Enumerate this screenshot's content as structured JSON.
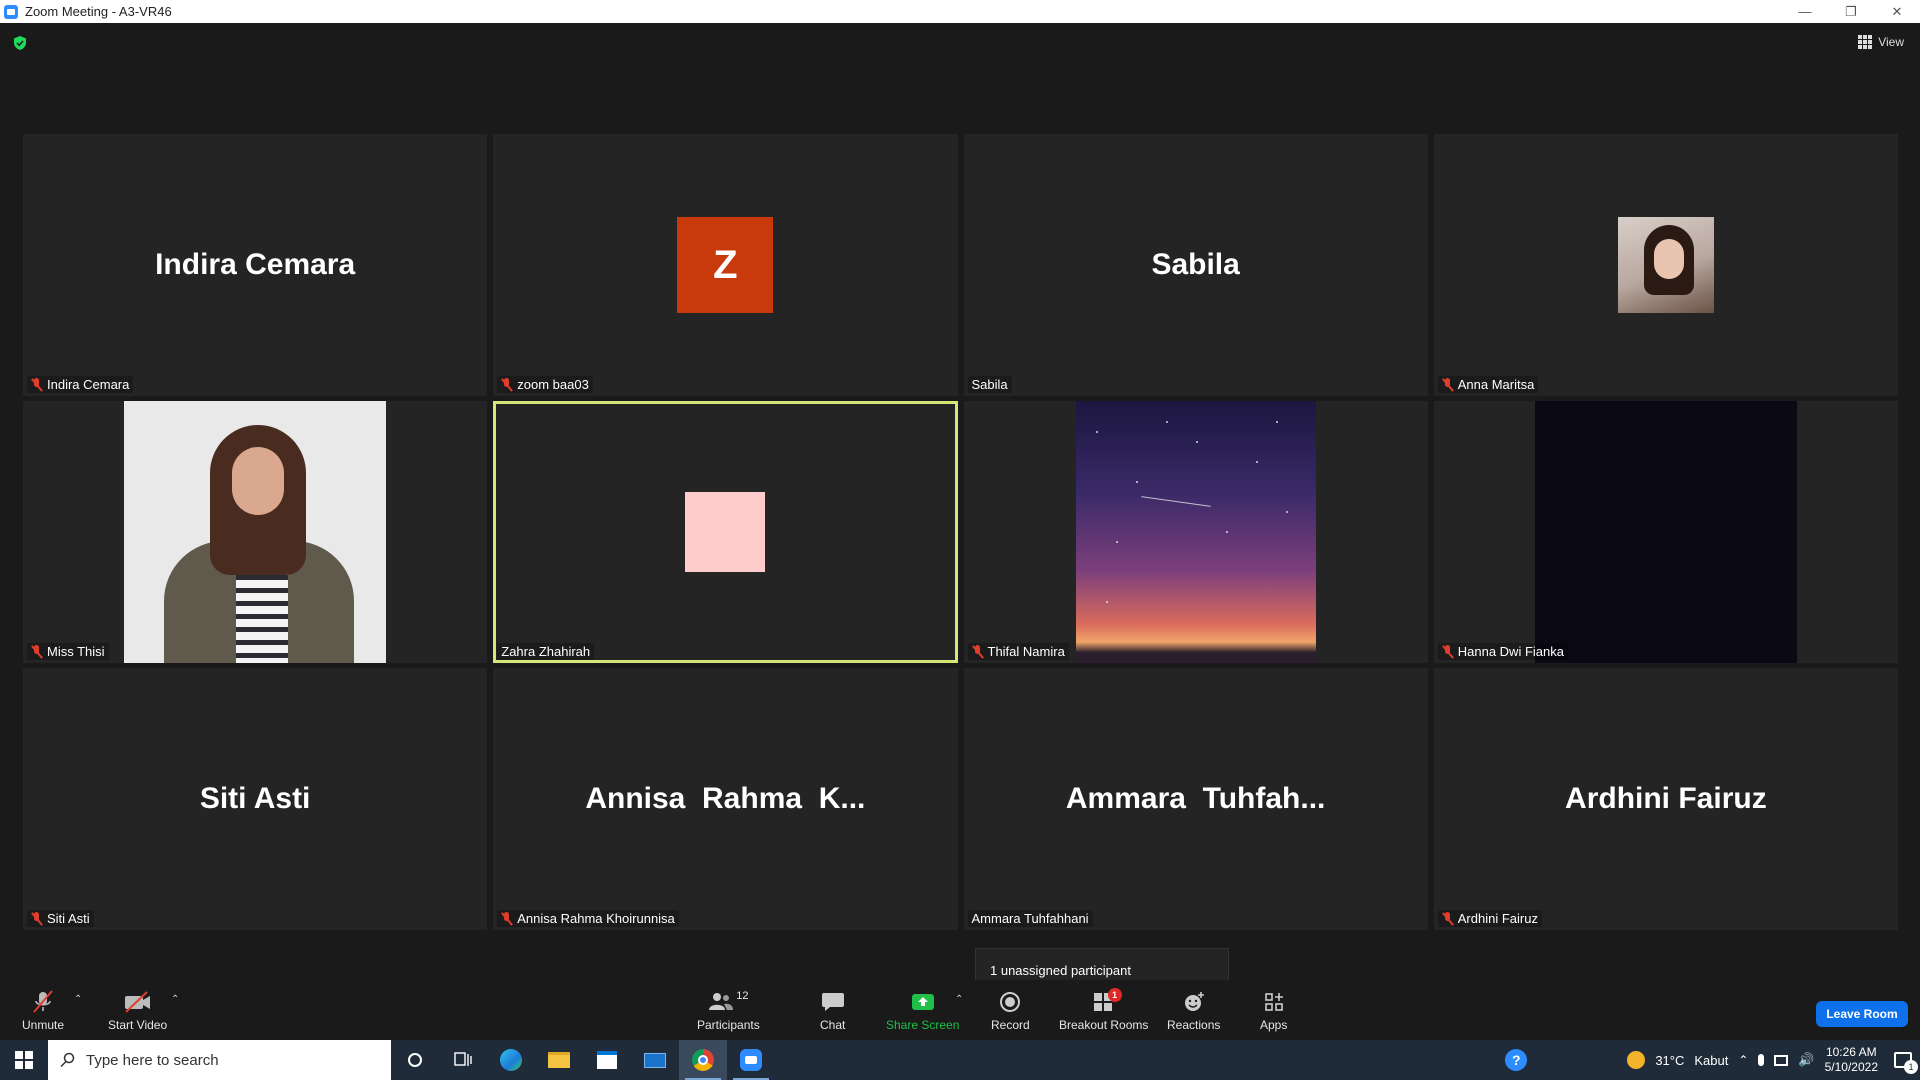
{
  "window": {
    "title": "Zoom Meeting - A3-VR46"
  },
  "header": {
    "view_label": "View"
  },
  "tiles": [
    {
      "display": "Indira Cemara",
      "label": "Indira Cemara",
      "muted": true
    },
    {
      "display": "Z",
      "label": "zoom baa03",
      "muted": true
    },
    {
      "display": "Sabila",
      "label": "Sabila",
      "muted": false
    },
    {
      "display": "",
      "label": "Anna Maritsa",
      "muted": true
    },
    {
      "display": "",
      "label": "Miss Thisi",
      "muted": true
    },
    {
      "display": "",
      "label": "Zahra Zhahirah",
      "muted": false,
      "active_speaker": true
    },
    {
      "display": "",
      "label": "Thifal Namira",
      "muted": true
    },
    {
      "display": "",
      "label": "Hanna Dwi Fianka",
      "muted": true
    },
    {
      "display": "Siti Asti",
      "label": "Siti Asti",
      "muted": true
    },
    {
      "display": "Annisa  Rahma  K...",
      "label": "Annisa Rahma Khoirunnisa",
      "muted": true
    },
    {
      "display": "Ammara  Tuhfah...",
      "label": "Ammara Tuhfahhani",
      "muted": false
    },
    {
      "display": "Ardhini Fairuz",
      "label": "Ardhini Fairuz",
      "muted": true
    }
  ],
  "tooltip": {
    "text": "1 unassigned participant"
  },
  "toolbar": {
    "unmute": "Unmute",
    "start_video": "Start Video",
    "participants": "Participants",
    "participants_count": "12",
    "chat": "Chat",
    "share_screen": "Share Screen",
    "record": "Record",
    "breakout_rooms": "Breakout Rooms",
    "breakout_badge": "1",
    "reactions": "Reactions",
    "apps": "Apps",
    "leave": "Leave Room"
  },
  "taskbar": {
    "search_placeholder": "Type here to search",
    "weather_temp": "31°C",
    "weather_text": "Kabut",
    "time": "10:26 AM",
    "date": "5/10/2022",
    "notification_count": "1"
  },
  "colors": {
    "active_border": "#d4e87a",
    "leave_button": "#0e71eb",
    "share_green": "#1fbf4a",
    "mute_red": "#e03e2d"
  }
}
